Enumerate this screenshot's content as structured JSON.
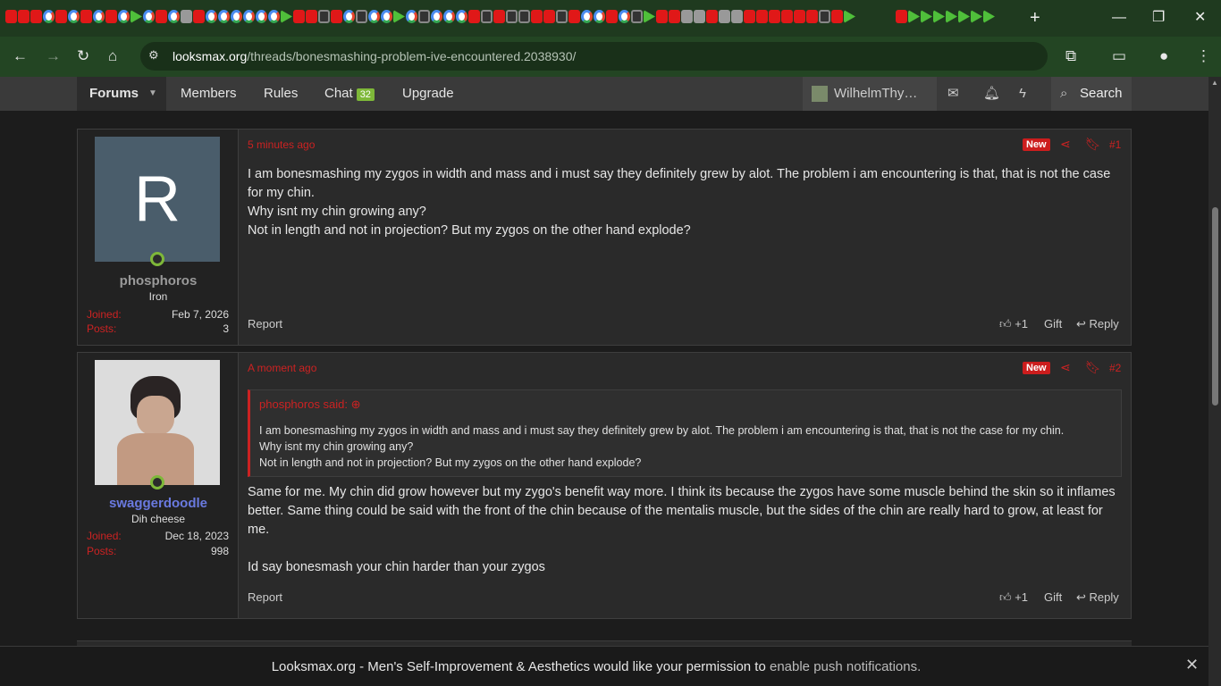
{
  "browser": {
    "url_host": "looksmax.org",
    "url_path": "/threads/bonesmashing-problem-ive-encountered.2038930/",
    "new_tab_label": "+",
    "minimize_label": "—",
    "maximize_label": "❐",
    "close_label": "✕"
  },
  "nav": {
    "forums": "Forums",
    "members": "Members",
    "rules": "Rules",
    "chat": "Chat",
    "chat_count": "32",
    "upgrade": "Upgrade",
    "user": "WilhelmThy…",
    "search": "Search"
  },
  "posts": [
    {
      "username": "phosphoros",
      "user_title": "Iron",
      "avatar_letter": "R",
      "joined_label": "Joined:",
      "joined": "Feb 7, 2026",
      "posts_label": "Posts:",
      "posts": "3",
      "time": "5 minutes ago",
      "new_label": "New",
      "number": "#1",
      "lines": [
        "I am bonesmashing my zygos in width and mass and i must say they definitely grew by alot. The problem i am encountering is that, that is not the case for my chin.",
        "Why isnt my chin growing any?",
        "Not in length and not in projection? But my zygos on the other hand explode?"
      ],
      "report": "Report",
      "like": "+1",
      "gift": "Gift",
      "reply": "Reply"
    },
    {
      "username": "swaggerdoodle",
      "user_title": "Dih cheese",
      "joined_label": "Joined:",
      "joined": "Dec 18, 2023",
      "posts_label": "Posts:",
      "posts": "998",
      "time": "A moment ago",
      "new_label": "New",
      "number": "#2",
      "quote_head": "phosphoros said:",
      "quote_lines": [
        "I am bonesmashing my zygos in width and mass and i must say they definitely grew by alot. The problem i am encountering is that, that is not the case for my chin.",
        "Why isnt my chin growing any?",
        "Not in length and not in projection? But my zygos on the other hand explode?"
      ],
      "para1": "Same for me. My chin did grow however but my zygo's benefit way more. I think its because the zygos have some muscle behind the skin so it inflames better. Same thing could be said with the front of the chin because of the mentalis muscle, but the sides of the chin are really hard to grow, at least for me.",
      "para2": "Id say bonesmash your chin harder than your zygos",
      "report": "Report",
      "like": "+1",
      "gift": "Gift",
      "reply": "Reply"
    }
  ],
  "push": {
    "text": "Looksmax.org - Men's Self-Improvement & Aesthetics would like your permission to",
    "link": "enable push notifications."
  },
  "colors": {
    "accent": "#cc2222",
    "online": "#7eb839",
    "browser": "#234523"
  }
}
